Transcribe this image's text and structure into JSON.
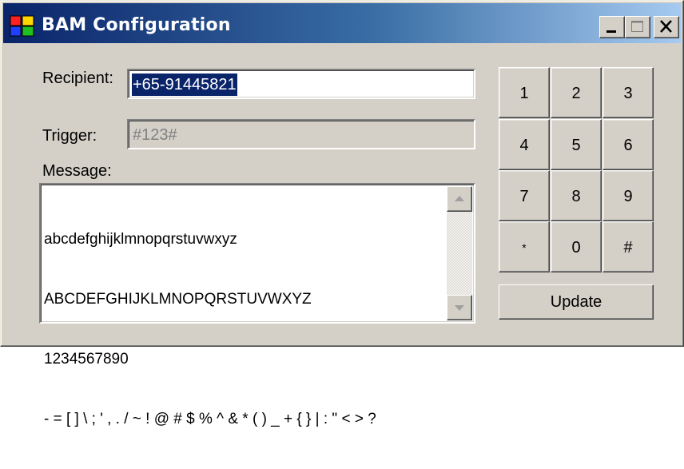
{
  "window": {
    "title": "BAM Configuration",
    "controls": {
      "minimize": "minimize-icon",
      "maximize": "maximize-icon",
      "close": "close-icon"
    }
  },
  "form": {
    "recipient_label": "Recipient:",
    "recipient_value": "+65-91445821",
    "trigger_label": "Trigger:",
    "trigger_value": "#123#",
    "message_label": "Message:",
    "message_lines": [
      "abcdefghijklmnopqrstuvwxyz",
      "ABCDEFGHIJKLMNOPQRSTUVWXYZ",
      "1234567890",
      "- = [ ] \\ ; ' , . / ~ ! @ # $ % ^ & * ( ) _ + { } | : \" < > ?"
    ]
  },
  "keypad": {
    "keys": [
      "1",
      "2",
      "3",
      "4",
      "5",
      "6",
      "7",
      "8",
      "9",
      "*",
      "0",
      "#"
    ]
  },
  "update_label": "Update",
  "colors": {
    "face": "#d4d0c8",
    "title_start": "#0a246a",
    "title_end": "#a6caf0",
    "selection": "#0a246a"
  }
}
